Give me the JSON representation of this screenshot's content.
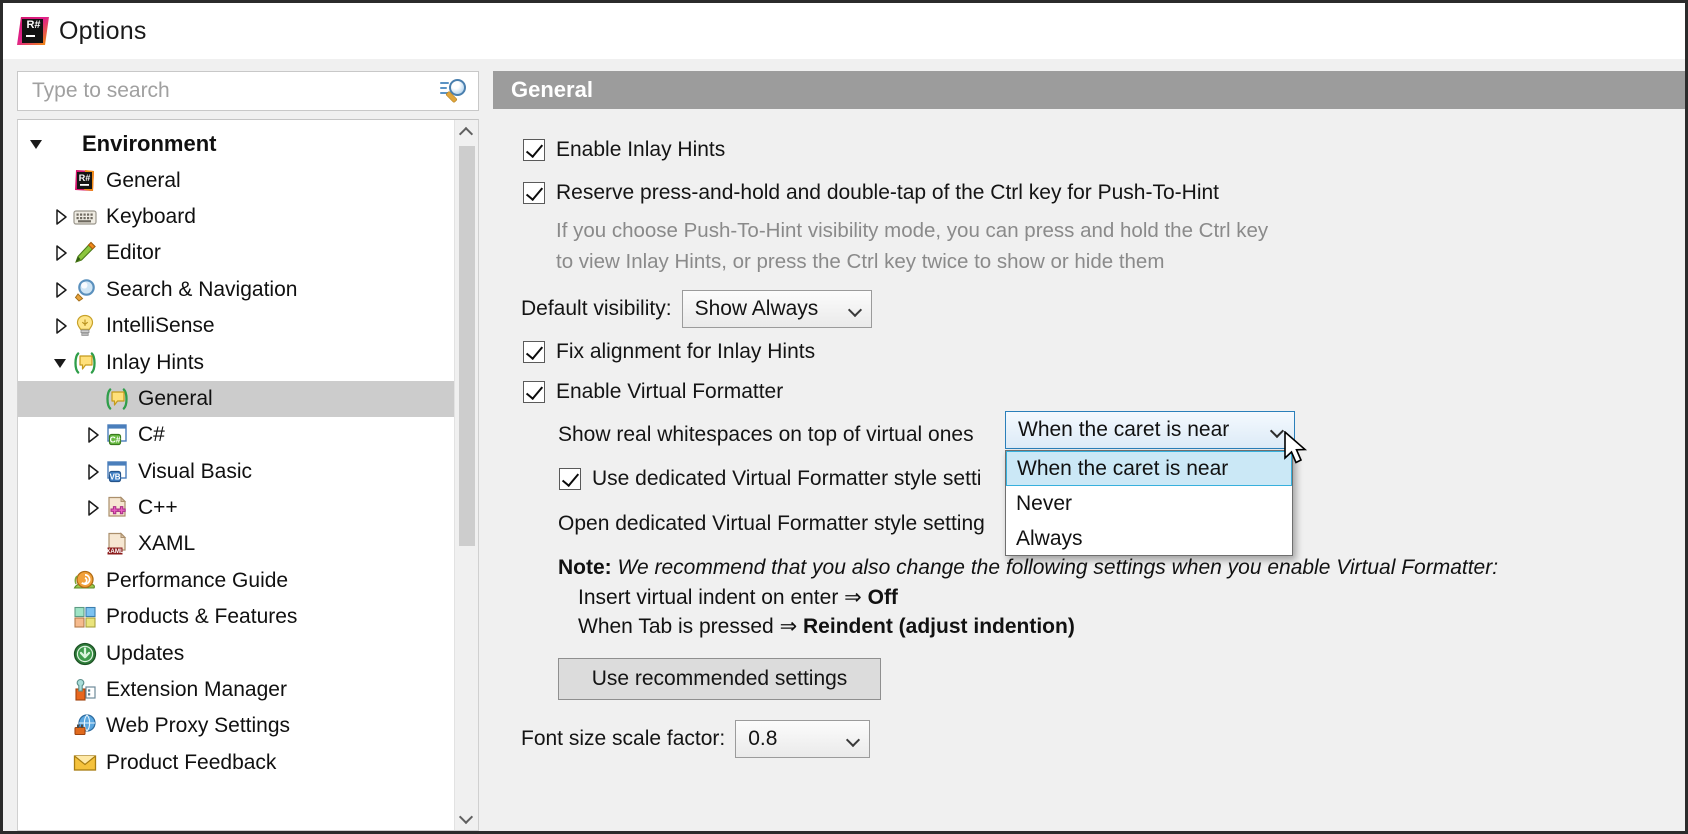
{
  "window": {
    "title": "Options",
    "logo_icon": "resharper-logo-icon",
    "logo_text": "R#"
  },
  "search": {
    "placeholder": "Type to search",
    "value": "",
    "icon": "search-settings-icon"
  },
  "sidebar": {
    "items": [
      {
        "label": "Environment",
        "level": 0,
        "expander": "expanded",
        "icon": "none",
        "selected": false
      },
      {
        "label": "General",
        "level": 1,
        "expander": "none",
        "icon": "resharper-icon",
        "selected": false
      },
      {
        "label": "Keyboard",
        "level": 1,
        "expander": "collapsed",
        "icon": "keyboard-icon",
        "selected": false
      },
      {
        "label": "Editor",
        "level": 1,
        "expander": "collapsed",
        "icon": "pencil-icon",
        "selected": false
      },
      {
        "label": "Search & Navigation",
        "level": 1,
        "expander": "collapsed",
        "icon": "magnifier-icon",
        "selected": false
      },
      {
        "label": "IntelliSense",
        "level": 1,
        "expander": "collapsed",
        "icon": "lightbulb-icon",
        "selected": false
      },
      {
        "label": "Inlay Hints",
        "level": 1,
        "expander": "expanded",
        "icon": "inlay-hints-icon",
        "selected": false
      },
      {
        "label": "General",
        "level": 2,
        "expander": "none",
        "icon": "inlay-hints-icon",
        "selected": true
      },
      {
        "label": "C#",
        "level": 2,
        "expander": "collapsed",
        "icon": "csharp-icon",
        "selected": false
      },
      {
        "label": "Visual Basic",
        "level": 2,
        "expander": "collapsed",
        "icon": "vb-icon",
        "selected": false
      },
      {
        "label": "C++",
        "level": 2,
        "expander": "collapsed",
        "icon": "cpp-icon",
        "selected": false
      },
      {
        "label": "XAML",
        "level": 2,
        "expander": "none",
        "icon": "xaml-icon",
        "selected": false
      },
      {
        "label": "Performance Guide",
        "level": 1,
        "expander": "none",
        "icon": "snail-icon",
        "selected": false
      },
      {
        "label": "Products & Features",
        "level": 1,
        "expander": "none",
        "icon": "products-icon",
        "selected": false
      },
      {
        "label": "Updates",
        "level": 1,
        "expander": "none",
        "icon": "updates-icon",
        "selected": false
      },
      {
        "label": "Extension Manager",
        "level": 1,
        "expander": "none",
        "icon": "extension-icon",
        "selected": false
      },
      {
        "label": "Web Proxy Settings",
        "level": 1,
        "expander": "none",
        "icon": "web-proxy-icon",
        "selected": false
      },
      {
        "label": "Product Feedback",
        "level": 1,
        "expander": "none",
        "icon": "envelope-icon",
        "selected": false
      }
    ]
  },
  "panel": {
    "header": "General",
    "enable_inlay_hints": {
      "label": "Enable Inlay Hints",
      "checked": true
    },
    "reserve_ctrl": {
      "label": "Reserve press-and-hold and double-tap of the Ctrl key for Push-To-Hint",
      "checked": true
    },
    "reserve_ctrl_hint_line1": "If you choose Push-To-Hint visibility mode, you can press and hold the Ctrl key",
    "reserve_ctrl_hint_line2": "to view Inlay Hints, or press the Ctrl key twice to show or hide them",
    "default_visibility": {
      "label": "Default visibility:",
      "value": "Show Always",
      "options": [
        "Show Always"
      ]
    },
    "fix_alignment": {
      "label": "Fix alignment for Inlay Hints",
      "checked": true
    },
    "enable_virtual_formatter": {
      "label": "Enable Virtual Formatter",
      "checked": true
    },
    "show_real_whitespaces": {
      "label": "Show real whitespaces on top of virtual ones",
      "value": "When the caret is near",
      "options": [
        "When the caret is near",
        "Never",
        "Always"
      ],
      "highlighted_option": "When the caret is near",
      "expanded": true
    },
    "dedicated_style": {
      "label": "Use dedicated Virtual Formatter style setti",
      "full_label": "Use dedicated Virtual Formatter style settings",
      "checked": true
    },
    "open_dedicated_link": "Open dedicated Virtual Formatter style setting",
    "note": {
      "prefix": "Note",
      "colon": ":",
      "body": "We recommend that you also change the following settings when you enable Virtual Formatter:",
      "line1_text": "Insert virtual indent on enter ",
      "line1_arrow": "⇒",
      "line1_value": "Off",
      "line2_text": "When Tab is pressed ",
      "line2_arrow": "⇒",
      "line2_value": "Reindent (adjust indention)"
    },
    "use_recommended_button": "Use recommended settings",
    "font_scale": {
      "label": "Font size scale factor:",
      "value": "0.8",
      "options": [
        "0.8"
      ]
    }
  },
  "colors": {
    "header_bar": "#9c9c9c",
    "panel_bg": "#f0f0f0",
    "selection": "#cccccc",
    "dropdown_highlight": "#cbe8f6",
    "dropdown_border": "#2a7fba",
    "hint_text": "#8a8a8a"
  }
}
